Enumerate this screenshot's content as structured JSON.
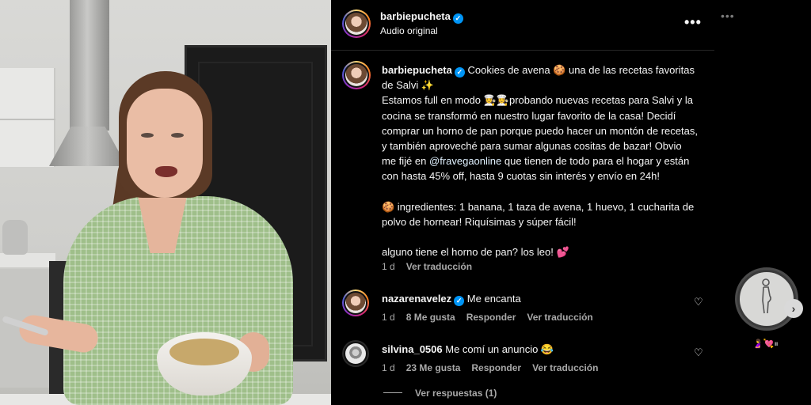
{
  "post": {
    "username": "barbiepucheta",
    "audio": "Audio original",
    "caption_lines": [
      "Cookies de avena 🍪 una de las recetas favoritas de Salvi ✨",
      "Estamos full en modo 👩‍🍳👩‍🍳probando nuevas recetas para Salvi y la cocina se transformó en nuestro lugar favorito de la casa! Decidí comprar un horno de pan porque puedo hacer un montón de recetas, y también aproveché para sumar algunas cositas de bazar! Obvio me fijé en",
      "@fravegaonline",
      " que tienen de todo para el hogar y están con hasta 45% off, hasta 9 cuotas sin interés y envío en 24h!",
      "🍪 ingredientes: 1 banana, 1 taza de avena, 1 huevo, 1 cucharita de polvo de hornear! Riquísimas y súper fácil!",
      "alguno tiene el horno de pan? los leo! 💕"
    ],
    "time": "1 d",
    "translate": "Ver traducción"
  },
  "comments": [
    {
      "username": "nazarenavelez",
      "text": "Me encanta",
      "time": "1 d",
      "likes": "8 Me gusta",
      "reply": "Responder",
      "translate": "Ver traducción"
    },
    {
      "username": "silvina_0506",
      "text": "Me comí un anuncio 😂",
      "time": "1 d",
      "likes": "23 Me gusta",
      "reply": "Responder",
      "translate": "Ver traducción"
    }
  ],
  "replies": "Ver respuestas (1)",
  "side": {
    "emojis": "🤰💘⏸"
  },
  "icons": {
    "more": "more-icon",
    "verified": "verified-badge-icon",
    "heart": "heart-icon",
    "next": "chevron-right-icon"
  },
  "colors": {
    "background": "#000000",
    "text": "#f5f5f5",
    "secondary": "#a8a8a8",
    "verified": "#0095f6",
    "mention": "#e0f1ff"
  }
}
